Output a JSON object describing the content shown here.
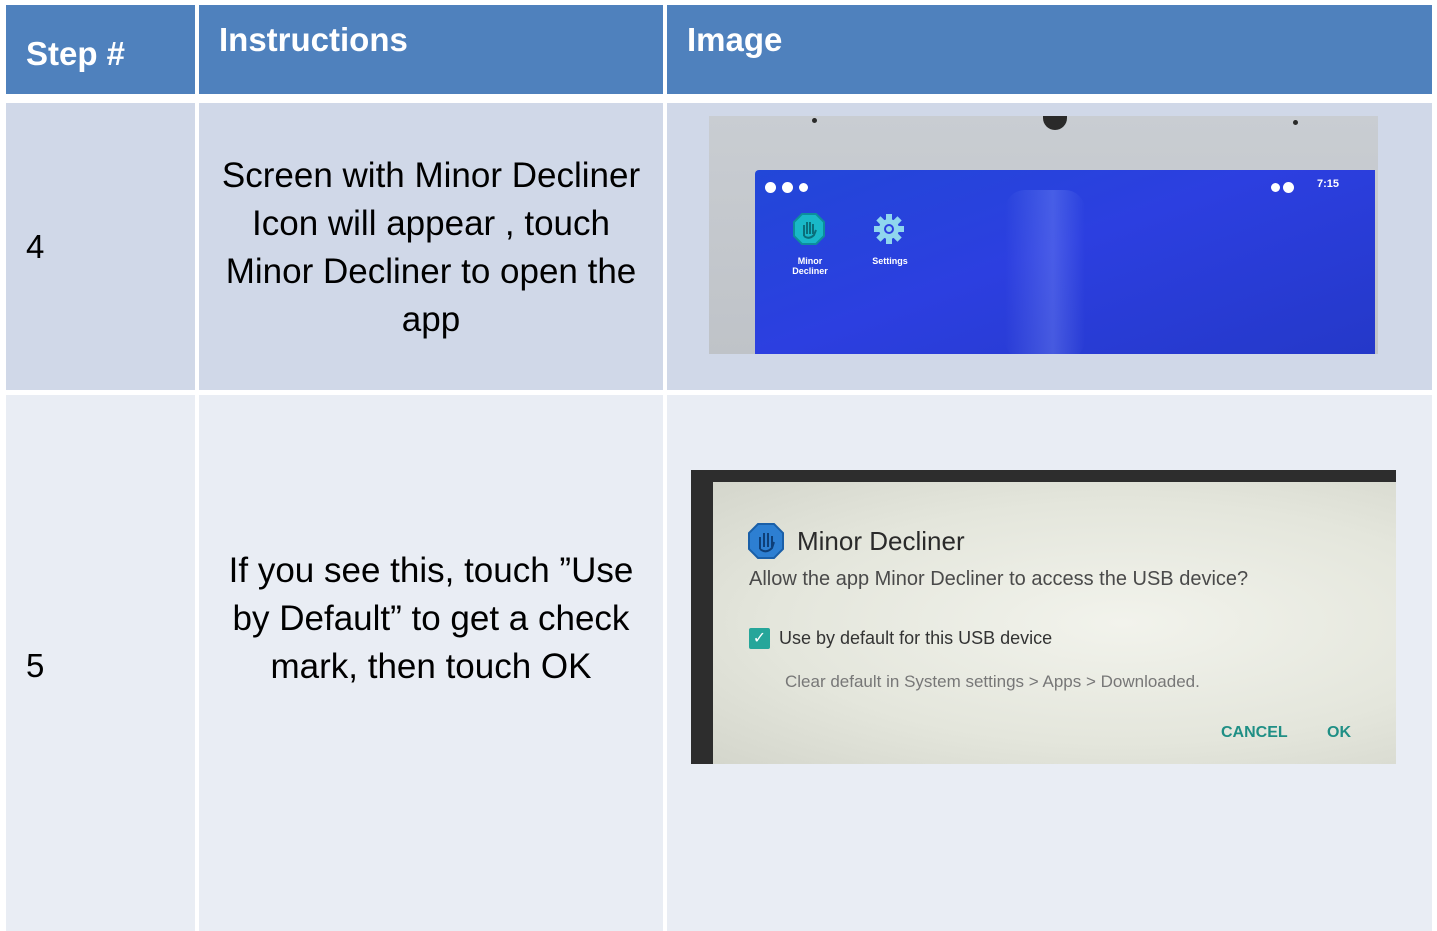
{
  "table": {
    "headers": {
      "step": "Step #",
      "instructions": "Instructions",
      "image": "Image"
    },
    "rows": [
      {
        "step": "4",
        "instruction": "Screen with Minor Decliner Icon will appear , touch Minor Decliner to open the app",
        "image": {
          "clock": "7:15",
          "apps": [
            {
              "label": "Minor Decliner",
              "icon": "hand-stop-icon"
            },
            {
              "label": "Settings",
              "icon": "gear-icon"
            }
          ]
        }
      },
      {
        "step": "5",
        "instruction": "If you see this, touch ”Use by Default” to get a check mark, then touch OK",
        "image": {
          "dialog_title": "Minor Decliner",
          "dialog_message": "Allow the app Minor Decliner to access the USB device?",
          "checkbox_label": "Use by default for this USB device",
          "checkbox_checked": true,
          "hint": "Clear default in System settings > Apps > Downloaded.",
          "cancel_label": "CANCEL",
          "ok_label": "OK"
        }
      }
    ]
  },
  "colors": {
    "header_bg": "#4f81bd",
    "row4_bg": "#d0d8e8",
    "row5_bg": "#e9edf4",
    "accent_teal": "#26a69a",
    "screen_blue": "#2c3fe0"
  }
}
